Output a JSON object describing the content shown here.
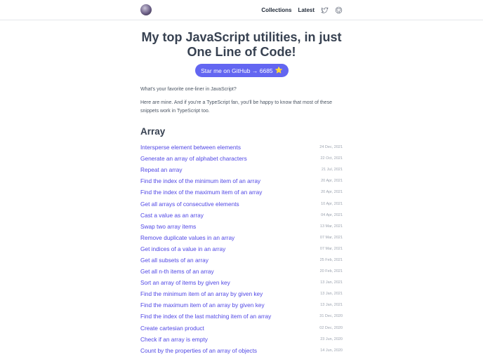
{
  "header": {
    "nav": {
      "collections": "Collections",
      "latest": "Latest"
    },
    "icons": [
      "twitter-icon",
      "github-icon"
    ]
  },
  "hero": {
    "title_line1": "My top JavaScript utilities, in just",
    "title_line2": "One Line of Code!",
    "star_button": "Star me on GitHub → 6685",
    "star_emoji": "⭐"
  },
  "intro": {
    "p1": "What's your favorite one-liner in JavaScript?",
    "p2": "Here are mine. And if you're a TypeScript fan, you'll be happy to know that most of these snippets work in TypeScript too."
  },
  "section": {
    "title": "Array"
  },
  "items": [
    {
      "title": "Intersperse element between elements",
      "date": "24 Dec, 2021"
    },
    {
      "title": "Generate an array of alphabet characters",
      "date": "22 Oct, 2021"
    },
    {
      "title": "Repeat an array",
      "date": "21 Jul, 2021"
    },
    {
      "title": "Find the index of the minimum item of an array",
      "date": "20 Apr, 2021"
    },
    {
      "title": "Find the index of the maximum item of an array",
      "date": "20 Apr, 2021"
    },
    {
      "title": "Get all arrays of consecutive elements",
      "date": "10 Apr, 2021"
    },
    {
      "title": "Cast a value as an array",
      "date": "04 Apr, 2021"
    },
    {
      "title": "Swap two array items",
      "date": "13 Mar, 2021"
    },
    {
      "title": "Remove duplicate values in an array",
      "date": "07 Mar, 2021"
    },
    {
      "title": "Get indices of a value in an array",
      "date": "07 Mar, 2021"
    },
    {
      "title": "Get all subsets of an array",
      "date": "25 Feb, 2021"
    },
    {
      "title": "Get all n-th items of an array",
      "date": "20 Feb, 2021"
    },
    {
      "title": "Sort an array of items by given key",
      "date": "13 Jan, 2021"
    },
    {
      "title": "Find the minimum item of an array by given key",
      "date": "13 Jan, 2021"
    },
    {
      "title": "Find the maximum item of an array by given key",
      "date": "13 Jan, 2021"
    },
    {
      "title": "Find the index of the last matching item of an array",
      "date": "31 Dec, 2020"
    },
    {
      "title": "Create cartesian product",
      "date": "02 Dec, 2020"
    },
    {
      "title": "Check if an array is empty",
      "date": "23 Jun, 2020"
    },
    {
      "title": "Count by the properties of an array of objects",
      "date": "14 Jun, 2020"
    }
  ],
  "colors": {
    "accent": "#6366f1",
    "link": "#4f46e5",
    "date": "#9ca3af"
  }
}
